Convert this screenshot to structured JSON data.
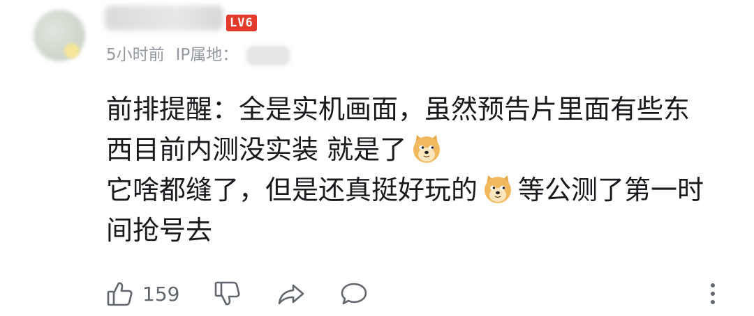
{
  "comment": {
    "level_badge": "LV6",
    "time_text": "5小时前",
    "ip_label": "IP属地：",
    "content_lines": [
      [
        "前排提醒：全是实机画面，虽然预告片里面有些东"
      ],
      [
        "西目前内测没实装 就是了"
      ],
      [
        "它啥都缝了，但是还真挺好玩的",
        "等公测了第一时"
      ],
      [
        "间抢号去"
      ]
    ],
    "emoji_name": "doge-emoji"
  },
  "actions": {
    "like_count": "159",
    "icons": [
      "thumbs-up-icon",
      "thumbs-down-icon",
      "share-icon",
      "reply-icon",
      "more-vertical-icon"
    ]
  },
  "colors": {
    "badge_red": "#e23a2b",
    "meta_gray": "#9499a0",
    "icon_gray": "#61666d"
  }
}
